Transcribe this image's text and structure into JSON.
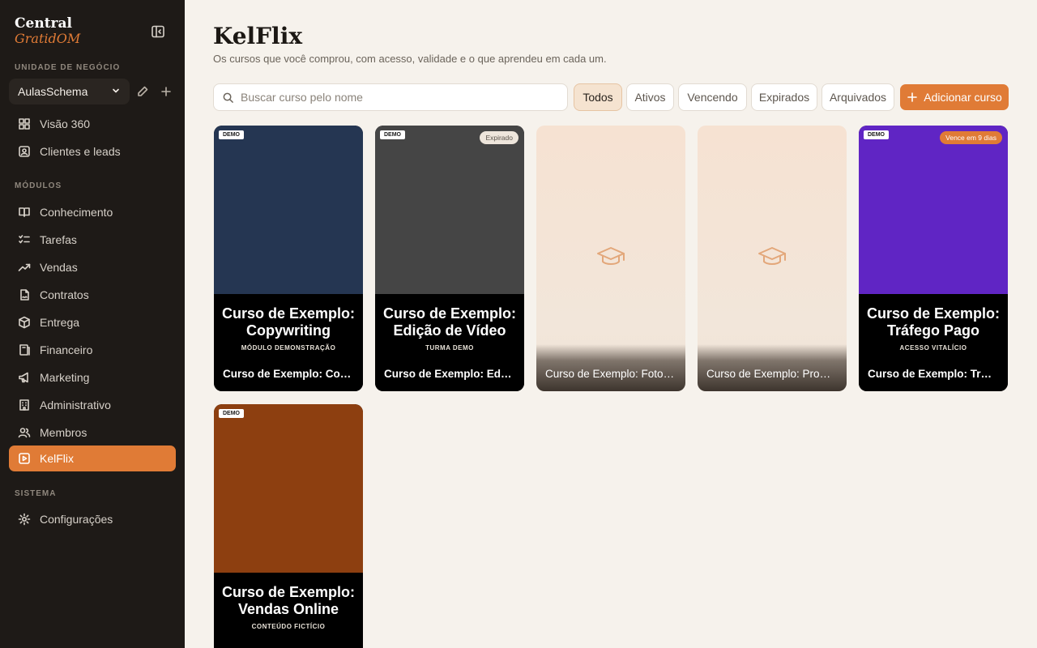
{
  "sidebar": {
    "brand_top": "Central",
    "brand_bottom": "GratidOM",
    "unit_label": "UNIDADE DE NEGÓCIO",
    "unit_value": "AulasSchema",
    "top_items": [
      {
        "label": "Visão 360",
        "icon": "dashboard-icon"
      },
      {
        "label": "Clientes e leads",
        "icon": "contacts-icon"
      }
    ],
    "modules_label": "MÓDULOS",
    "module_items": [
      {
        "label": "Conhecimento",
        "icon": "book-icon"
      },
      {
        "label": "Tarefas",
        "icon": "checklist-icon"
      },
      {
        "label": "Vendas",
        "icon": "trend-icon"
      },
      {
        "label": "Contratos",
        "icon": "contract-icon"
      },
      {
        "label": "Entrega",
        "icon": "package-icon"
      },
      {
        "label": "Financeiro",
        "icon": "wallet-icon"
      },
      {
        "label": "Marketing",
        "icon": "megaphone-icon"
      },
      {
        "label": "Administrativo",
        "icon": "building-icon"
      },
      {
        "label": "Membros",
        "icon": "members-icon"
      },
      {
        "label": "KelFlix",
        "icon": "play-square-icon",
        "active": true
      }
    ],
    "system_label": "SISTEMA",
    "system_items": [
      {
        "label": "Configurações",
        "icon": "gear-icon"
      }
    ]
  },
  "main": {
    "title": "KelFlix",
    "subtitle": "Os cursos que você comprou, com acesso, validade e o que aprendeu em cada um.",
    "search_placeholder": "Buscar curso pelo nome",
    "filters": [
      "Todos",
      "Ativos",
      "Vencendo",
      "Expirados",
      "Arquivados"
    ],
    "active_filter": "Todos",
    "add_button": "Adicionar curso",
    "accent": "#e07b36"
  },
  "courses": [
    {
      "name": "Curso de Exemplo: Copywriting",
      "cover_title": "Curso de Exemplo: Copywriting",
      "cover_caption": "MÓDULO DEMONSTRAÇÃO",
      "badge": "DEMO",
      "status": "",
      "cover_color": "#253652"
    },
    {
      "name": "Curso de Exemplo: Edição de Vídeo",
      "cover_title": "Curso de Exemplo: Edição de Vídeo",
      "cover_caption": "TURMA DEMO",
      "badge": "DEMO",
      "status": "Expirado",
      "cover_color": "#454545"
    },
    {
      "name": "Curso de Exemplo: Fotografia",
      "placeholder": true
    },
    {
      "name": "Curso de Exemplo: Produtividade",
      "placeholder": true
    },
    {
      "name": "Curso de Exemplo: Tráfego Pago",
      "cover_title": "Curso de Exemplo: Tráfego Pago",
      "cover_caption": "ACESSO VITALÍCIO",
      "badge": "DEMO",
      "status": "Vence em 9 dias",
      "cover_color": "#6025c4"
    },
    {
      "name": "Curso de Exemplo: Vendas Online",
      "cover_title": "Curso de Exemplo: Vendas Online",
      "cover_caption": "CONTEÚDO FICTÍCIO",
      "badge": "DEMO",
      "status": "",
      "cover_color": "#8d3f10"
    }
  ]
}
